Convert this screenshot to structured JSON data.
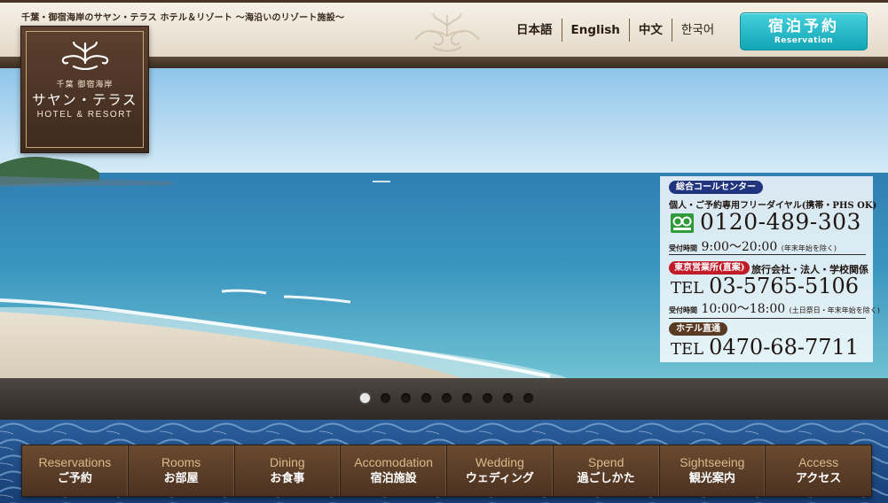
{
  "header": {
    "tagline": "千葉・御宿海岸のサヤン・テラス ホテル＆リゾート 〜海沿いのリゾート施設〜",
    "languages": [
      {
        "label": "日本語"
      },
      {
        "label": "English"
      },
      {
        "label": "中文"
      },
      {
        "label": "한국어"
      }
    ],
    "reserve": {
      "main": "宿泊予約",
      "sub": "Reservation"
    }
  },
  "logo": {
    "sub": "千葉 御宿海岸",
    "name": "サヤン・テラス",
    "english": "HOTEL & RESORT"
  },
  "contact": {
    "call_center_badge": "総合コールセンター",
    "freedial_desc": "個人・ご予約専用フリーダイヤル(携帯・PHS OK)",
    "freedial_number": "0120-489-303",
    "hours1_label": "受付時間",
    "hours1_time": "9:00〜20:00",
    "hours1_note": "(年末年始を除く)",
    "tokyo_badge": "東京営業所(直案)",
    "tokyo_desc": "旅行会社・法人・学校関係",
    "tel_label": "TEL",
    "tokyo_number": "03-5765-5106",
    "hours2_label": "受付時間",
    "hours2_time": "10:00〜18:00",
    "hours2_note": "(土日祭日・年末年始を除く)",
    "hotel_badge": "ホテル直通",
    "hotel_number": "0470-68-7711"
  },
  "slider": {
    "total": 9,
    "active_index": 0
  },
  "nav": [
    {
      "en": "Reservations",
      "ja": "ご予約"
    },
    {
      "en": "Rooms",
      "ja": "お部屋"
    },
    {
      "en": "Dining",
      "ja": "お食事"
    },
    {
      "en": "Accomodation",
      "ja": "宿泊施設"
    },
    {
      "en": "Wedding",
      "ja": "ウェディング"
    },
    {
      "en": "Spend",
      "ja": "過ごしかた"
    },
    {
      "en": "Sightseeing",
      "ja": "観光案内"
    },
    {
      "en": "Access",
      "ja": "アクセス"
    }
  ],
  "colors": {
    "reserve_button": "#1ab0be",
    "header_brown": "#4a3424",
    "nav_brown": "#5c3f29",
    "badge_blue": "#21357f",
    "badge_red": "#c01b27"
  }
}
